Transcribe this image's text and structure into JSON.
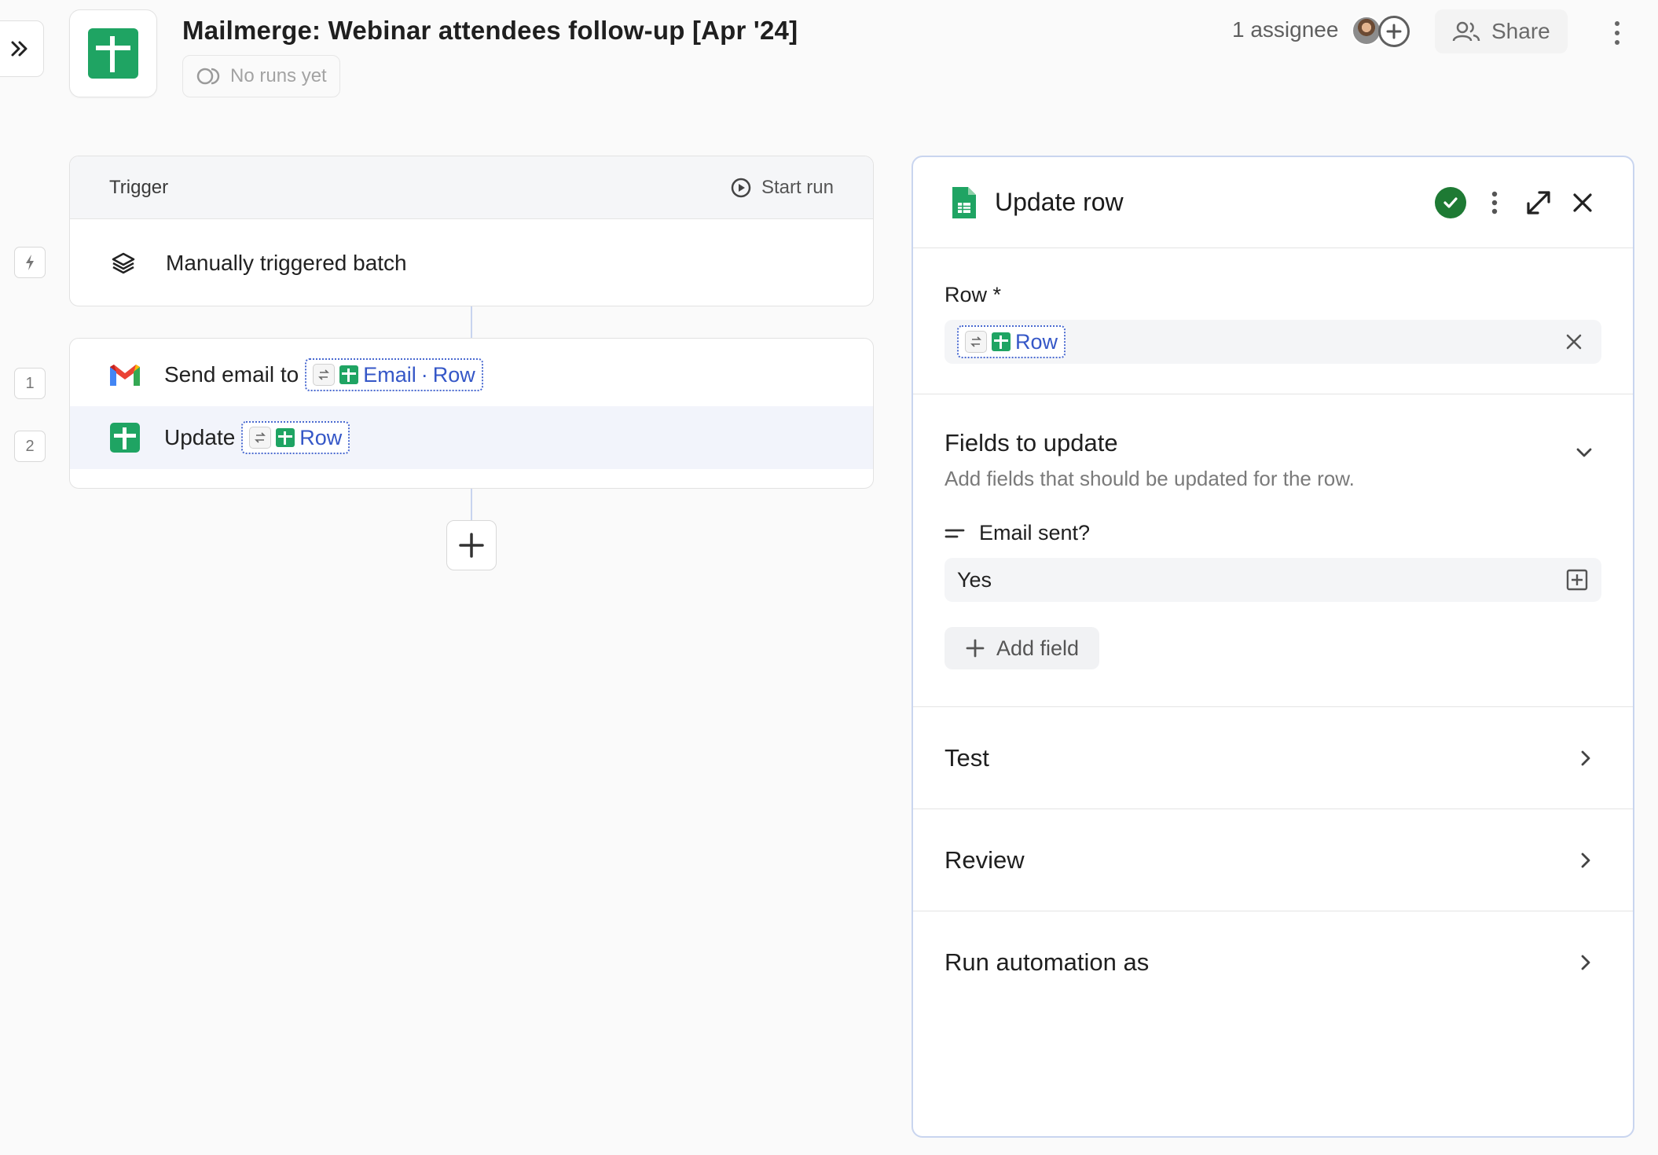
{
  "header": {
    "title": "Mailmerge: Webinar attendees follow-up [Apr '24]",
    "runs_status": "No runs yet",
    "assignees": "1 assignee",
    "share_label": "Share"
  },
  "flow": {
    "trigger": {
      "label": "Trigger",
      "start_run": "Start run",
      "name": "Manually triggered batch"
    },
    "steps": [
      {
        "number": "1",
        "action": "Send email to",
        "token_field": "Email",
        "token_separator": "·",
        "token_source": "Row"
      },
      {
        "number": "2",
        "action": "Update",
        "token_source": "Row"
      }
    ]
  },
  "panel": {
    "title": "Update row",
    "row_field": {
      "label": "Row *",
      "token": "Row"
    },
    "fields_section": {
      "title": "Fields to update",
      "description": "Add fields that should be updated for the row.",
      "field_name": "Email sent?",
      "field_value": "Yes",
      "add_field_label": "Add field"
    },
    "sections": [
      "Test",
      "Review",
      "Run automation as"
    ]
  },
  "colors": {
    "sheets_green": "#1fa463",
    "token_blue": "#3557c7",
    "success_green": "#1e7a34",
    "selected_row_bg": "#f2f4fb"
  }
}
